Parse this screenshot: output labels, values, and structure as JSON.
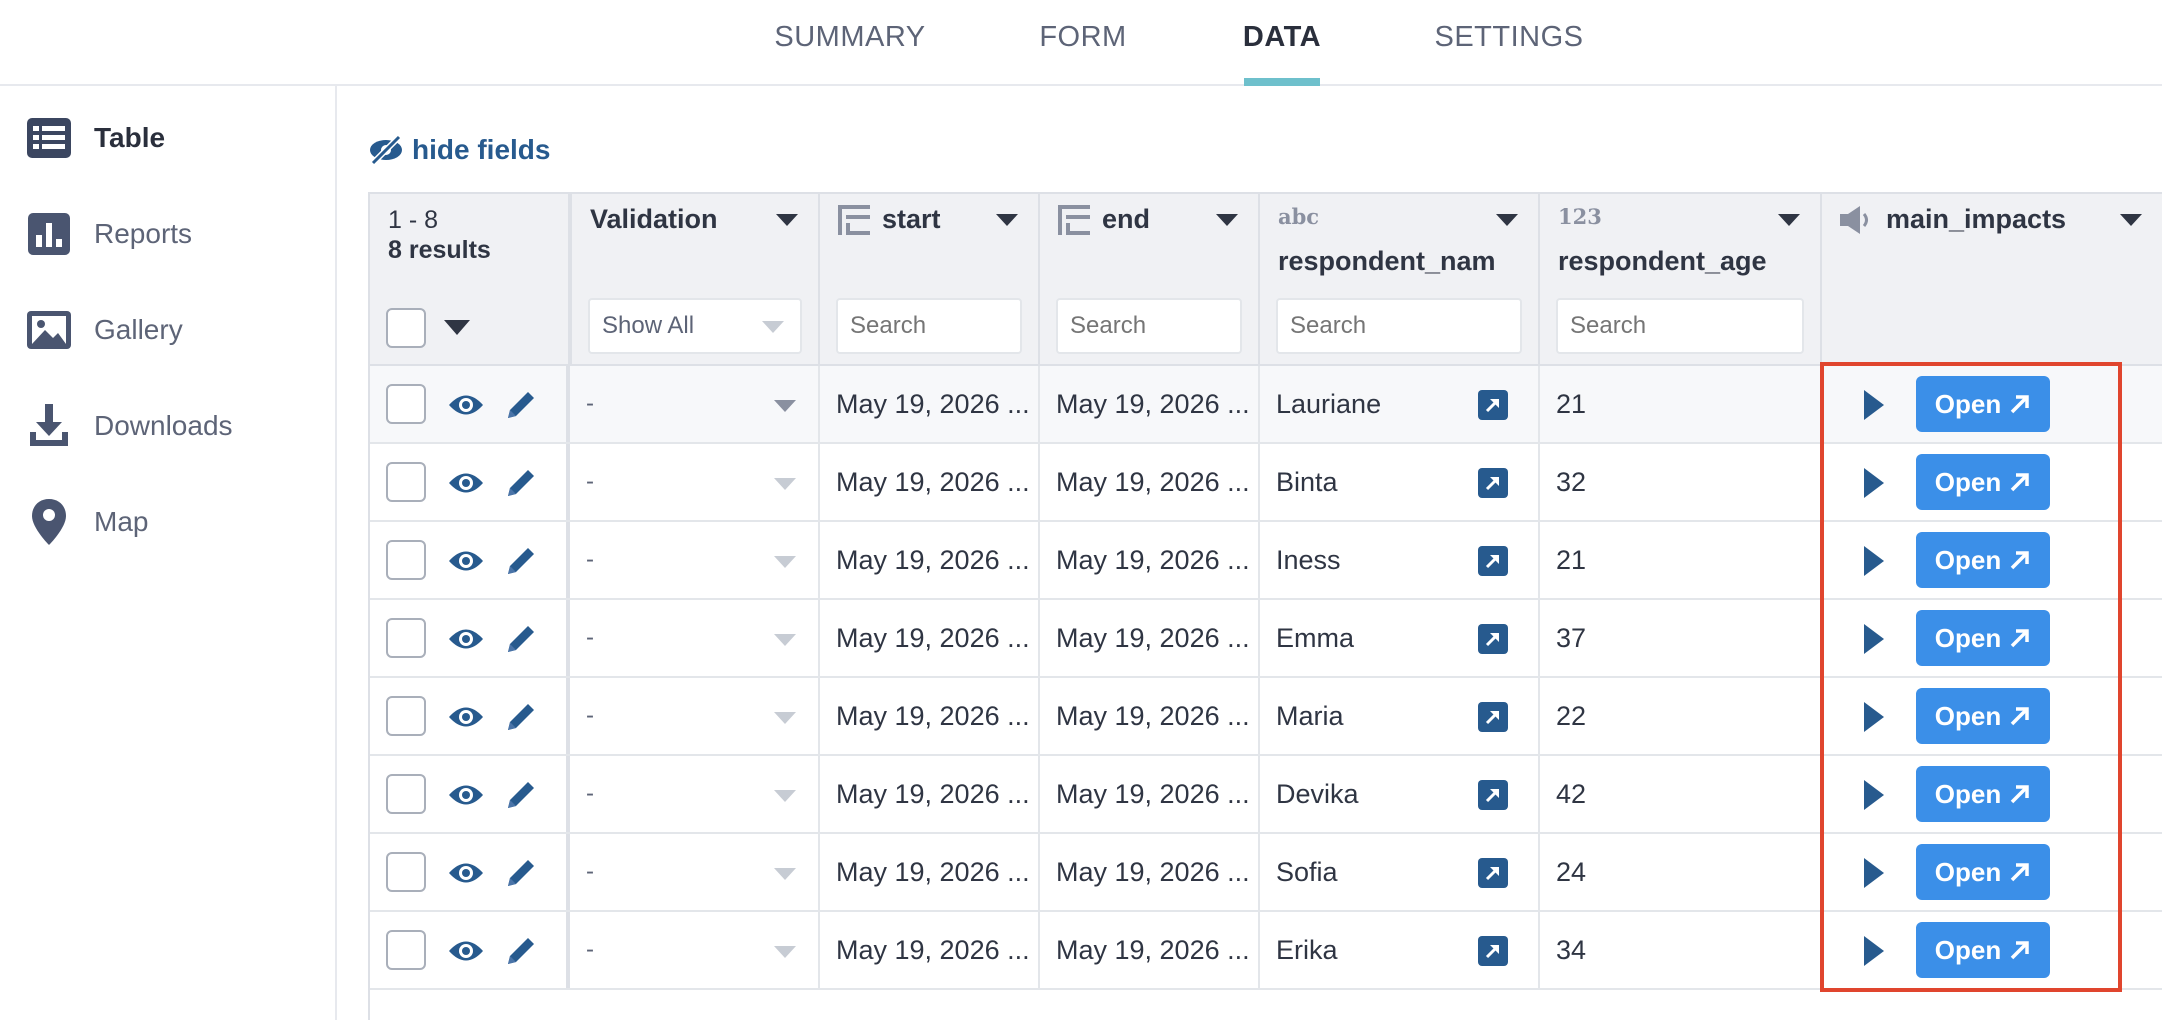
{
  "tabs": [
    {
      "label": "SUMMARY",
      "active": false
    },
    {
      "label": "FORM",
      "active": false
    },
    {
      "label": "DATA",
      "active": true
    },
    {
      "label": "SETTINGS",
      "active": false
    }
  ],
  "sidebar": {
    "items": [
      {
        "label": "Table",
        "icon": "table-icon",
        "active": true
      },
      {
        "label": "Reports",
        "icon": "bar-chart-icon",
        "active": false
      },
      {
        "label": "Gallery",
        "icon": "image-icon",
        "active": false
      },
      {
        "label": "Downloads",
        "icon": "download-icon",
        "active": false
      },
      {
        "label": "Map",
        "icon": "map-pin-icon",
        "active": false
      }
    ]
  },
  "toolbar": {
    "hide_fields_label": "hide fields"
  },
  "table": {
    "range": "1 - 8",
    "results": "8 results",
    "columns": {
      "validation": {
        "title": "Validation",
        "filter_value": "Show All"
      },
      "start": {
        "title": "start",
        "placeholder": "Search"
      },
      "end": {
        "title": "end",
        "placeholder": "Search"
      },
      "respondent_name": {
        "type_badge": "abc",
        "title": "respondent_nam",
        "placeholder": "Search"
      },
      "respondent_age": {
        "type_badge": "123",
        "title": "respondent_age",
        "placeholder": "Search"
      },
      "main_impacts": {
        "title": "main_impacts"
      }
    },
    "rows": [
      {
        "validation": "-",
        "start": "May 19, 2026 ...",
        "end": "May 19, 2026 ...",
        "name": "Lauriane",
        "age": "21",
        "open_label": "Open"
      },
      {
        "validation": "-",
        "start": "May 19, 2026 ...",
        "end": "May 19, 2026 ...",
        "name": "Binta",
        "age": "32",
        "open_label": "Open"
      },
      {
        "validation": "-",
        "start": "May 19, 2026 ...",
        "end": "May 19, 2026 ...",
        "name": "Iness",
        "age": "21",
        "open_label": "Open"
      },
      {
        "validation": "-",
        "start": "May 19, 2026 ...",
        "end": "May 19, 2026 ...",
        "name": "Emma",
        "age": "37",
        "open_label": "Open"
      },
      {
        "validation": "-",
        "start": "May 19, 2026 ...",
        "end": "May 19, 2026 ...",
        "name": "Maria",
        "age": "22",
        "open_label": "Open"
      },
      {
        "validation": "-",
        "start": "May 19, 2026 ...",
        "end": "May 19, 2026 ...",
        "name": "Devika",
        "age": "42",
        "open_label": "Open"
      },
      {
        "validation": "-",
        "start": "May 19, 2026 ...",
        "end": "May 19, 2026 ...",
        "name": "Sofia",
        "age": "24",
        "open_label": "Open"
      },
      {
        "validation": "-",
        "start": "May 19, 2026 ...",
        "end": "May 19, 2026 ...",
        "name": "Erika",
        "age": "34",
        "open_label": "Open"
      }
    ]
  },
  "colors": {
    "accent_tab": "#6ec0cc",
    "link_blue": "#275a8e",
    "button_blue": "#3b8fe8",
    "highlight_red": "#e0452e"
  }
}
